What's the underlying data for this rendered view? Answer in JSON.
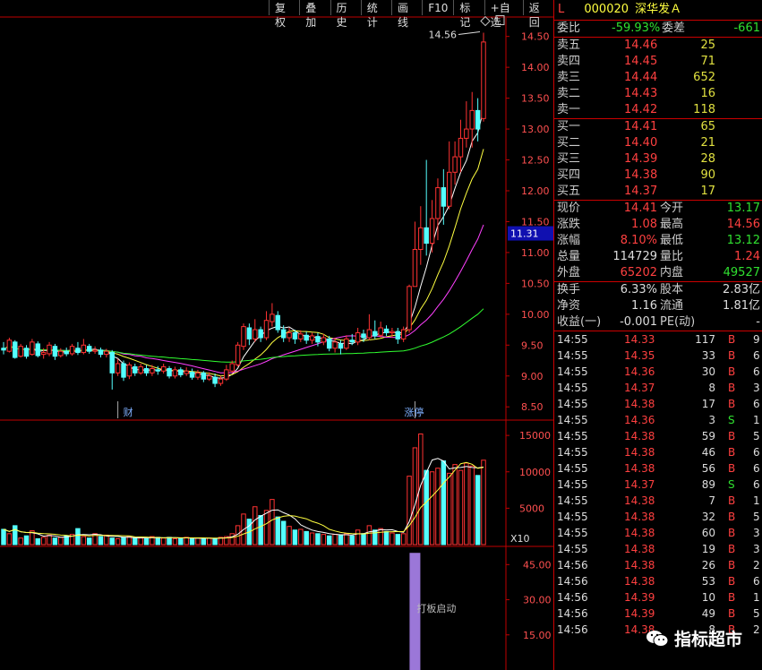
{
  "toolbar": {
    "items": [
      "复权",
      "叠加",
      "历史",
      "统计",
      "画线",
      "F10",
      "标记",
      "+自选",
      "返回"
    ]
  },
  "stock": {
    "market": "L",
    "code": "000020",
    "name": "深华发Ａ"
  },
  "committee": {
    "ratio_label": "委比",
    "ratio_value": "-59.93%",
    "diff_label": "委差",
    "diff_value": "-661"
  },
  "asks": [
    {
      "label": "卖五",
      "price": "14.46",
      "vol": "25"
    },
    {
      "label": "卖四",
      "price": "14.45",
      "vol": "71"
    },
    {
      "label": "卖三",
      "price": "14.44",
      "vol": "652"
    },
    {
      "label": "卖二",
      "price": "14.43",
      "vol": "16"
    },
    {
      "label": "卖一",
      "price": "14.42",
      "vol": "118"
    }
  ],
  "bids": [
    {
      "label": "买一",
      "price": "14.41",
      "vol": "65"
    },
    {
      "label": "买二",
      "price": "14.40",
      "vol": "21"
    },
    {
      "label": "买三",
      "price": "14.39",
      "vol": "28"
    },
    {
      "label": "买四",
      "price": "14.38",
      "vol": "90"
    },
    {
      "label": "买五",
      "price": "14.37",
      "vol": "17"
    }
  ],
  "quote": [
    {
      "l1": "现价",
      "v1": "14.41",
      "c1": "red",
      "l2": "今开",
      "v2": "13.17",
      "c2": "green"
    },
    {
      "l1": "涨跌",
      "v1": "1.08",
      "c1": "red",
      "l2": "最高",
      "v2": "14.56",
      "c2": "red"
    },
    {
      "l1": "涨幅",
      "v1": "8.10%",
      "c1": "red",
      "l2": "最低",
      "v2": "13.12",
      "c2": "green"
    },
    {
      "l1": "总量",
      "v1": "114729",
      "c1": "white",
      "l2": "量比",
      "v2": "1.24",
      "c2": "red"
    },
    {
      "l1": "外盘",
      "v1": "65202",
      "c1": "red",
      "l2": "内盘",
      "v2": "49527",
      "c2": "green"
    }
  ],
  "fundamentals": [
    {
      "l1": "换手",
      "v1": "6.33%",
      "l2": "股本",
      "v2": "2.83亿"
    },
    {
      "l1": "净资",
      "v1": "1.16",
      "l2": "流通",
      "v2": "1.81亿"
    },
    {
      "l1": "收益(一)",
      "v1": "-0.001",
      "l2": "PE(动)",
      "v2": "-"
    }
  ],
  "ticks": [
    {
      "time": "14:55",
      "price": "14.33",
      "vol": "117",
      "bs": "B",
      "n": "9"
    },
    {
      "time": "14:55",
      "price": "14.35",
      "vol": "33",
      "bs": "B",
      "n": "6"
    },
    {
      "time": "14:55",
      "price": "14.36",
      "vol": "30",
      "bs": "B",
      "n": "6"
    },
    {
      "time": "14:55",
      "price": "14.37",
      "vol": "8",
      "bs": "B",
      "n": "3"
    },
    {
      "time": "14:55",
      "price": "14.38",
      "vol": "17",
      "bs": "B",
      "n": "6"
    },
    {
      "time": "14:55",
      "price": "14.36",
      "vol": "3",
      "bs": "S",
      "n": "1"
    },
    {
      "time": "14:55",
      "price": "14.38",
      "vol": "59",
      "bs": "B",
      "n": "5"
    },
    {
      "time": "14:55",
      "price": "14.38",
      "vol": "46",
      "bs": "B",
      "n": "6"
    },
    {
      "time": "14:55",
      "price": "14.38",
      "vol": "56",
      "bs": "B",
      "n": "6"
    },
    {
      "time": "14:55",
      "price": "14.37",
      "vol": "89",
      "bs": "S",
      "n": "6"
    },
    {
      "time": "14:55",
      "price": "14.38",
      "vol": "7",
      "bs": "B",
      "n": "1"
    },
    {
      "time": "14:55",
      "price": "14.38",
      "vol": "32",
      "bs": "B",
      "n": "5"
    },
    {
      "time": "14:55",
      "price": "14.38",
      "vol": "60",
      "bs": "B",
      "n": "3"
    },
    {
      "time": "14:55",
      "price": "14.38",
      "vol": "19",
      "bs": "B",
      "n": "3"
    },
    {
      "time": "14:56",
      "price": "14.38",
      "vol": "26",
      "bs": "B",
      "n": "2"
    },
    {
      "time": "14:56",
      "price": "14.38",
      "vol": "53",
      "bs": "B",
      "n": "6"
    },
    {
      "time": "14:56",
      "price": "14.39",
      "vol": "10",
      "bs": "B",
      "n": "1"
    },
    {
      "time": "14:56",
      "price": "14.39",
      "vol": "49",
      "bs": "B",
      "n": "5"
    },
    {
      "time": "14:56",
      "price": "14.38",
      "vol": "8",
      "bs": "B",
      "n": "2"
    }
  ],
  "watermark": "指标超市",
  "colors": {
    "up": "#ff3232",
    "down": "#54ffff",
    "ma5": "#ffffff",
    "ma10": "#ffff40",
    "ma20": "#ff40ff",
    "ma60": "#30ff30",
    "indicator": "#9b77d8",
    "divider": "#c00000"
  },
  "chart_data": [
    {
      "type": "candlestick",
      "price_axis": {
        "ticks": [
          "14.50",
          "14.00",
          "13.50",
          "13.00",
          "12.50",
          "12.00",
          "11.50",
          "11.00",
          "10.50",
          "10.00",
          "9.50",
          "9.00",
          "8.50"
        ],
        "ylim": [
          8.3,
          14.8
        ],
        "current_marker": "11.31"
      },
      "high_marker": "14.56",
      "annotations": [
        {
          "text": "财",
          "index": 20
        },
        {
          "text": "涨停",
          "index": 72
        }
      ],
      "candles": [
        [
          9.45,
          9.42,
          9.55,
          9.35
        ],
        [
          9.4,
          9.58,
          9.62,
          9.38
        ],
        [
          9.55,
          9.3,
          9.58,
          9.28
        ],
        [
          9.32,
          9.48,
          9.52,
          9.3
        ],
        [
          9.45,
          9.32,
          9.5,
          9.28
        ],
        [
          9.35,
          9.55,
          9.6,
          9.33
        ],
        [
          9.52,
          9.33,
          9.56,
          9.3
        ],
        [
          9.35,
          9.38,
          9.45,
          9.28
        ],
        [
          9.36,
          9.5,
          9.55,
          9.32
        ],
        [
          9.48,
          9.32,
          9.52,
          9.26
        ],
        [
          9.33,
          9.4,
          9.45,
          9.3
        ],
        [
          9.4,
          9.36,
          9.46,
          9.32
        ],
        [
          9.36,
          9.48,
          9.52,
          9.33
        ],
        [
          9.45,
          9.38,
          9.55,
          9.34
        ],
        [
          9.38,
          9.5,
          9.6,
          9.35
        ],
        [
          9.48,
          9.4,
          9.52,
          9.36
        ],
        [
          9.4,
          9.42,
          9.48,
          9.36
        ],
        [
          9.42,
          9.35,
          9.46,
          9.3
        ],
        [
          9.35,
          9.4,
          9.44,
          9.3
        ],
        [
          9.38,
          9.05,
          9.42,
          8.78
        ],
        [
          9.05,
          9.2,
          9.28,
          9.0
        ],
        [
          9.2,
          8.98,
          9.25,
          8.92
        ],
        [
          9.0,
          9.18,
          9.22,
          8.95
        ],
        [
          9.15,
          9.05,
          9.2,
          9.0
        ],
        [
          9.05,
          9.15,
          9.2,
          9.02
        ],
        [
          9.12,
          9.05,
          9.18,
          9.0
        ],
        [
          9.05,
          9.12,
          9.18,
          9.0
        ],
        [
          9.1,
          9.08,
          9.16,
          9.02
        ],
        [
          9.08,
          9.15,
          9.2,
          9.04
        ],
        [
          9.12,
          9.0,
          9.16,
          8.96
        ],
        [
          9.0,
          9.1,
          9.15,
          8.96
        ],
        [
          9.1,
          9.02,
          9.14,
          8.98
        ],
        [
          9.04,
          9.08,
          9.14,
          9.0
        ],
        [
          9.06,
          8.98,
          9.12,
          8.94
        ],
        [
          8.98,
          9.05,
          9.1,
          8.94
        ],
        [
          9.05,
          8.95,
          9.08,
          8.9
        ],
        [
          8.95,
          9.0,
          9.06,
          8.92
        ],
        [
          8.98,
          8.88,
          9.04,
          8.82
        ],
        [
          8.88,
          8.95,
          9.0,
          8.84
        ],
        [
          8.95,
          9.1,
          9.18,
          8.92
        ],
        [
          9.08,
          9.2,
          9.25,
          9.05
        ],
        [
          9.18,
          9.5,
          9.55,
          9.15
        ],
        [
          9.48,
          9.8,
          9.85,
          9.42
        ],
        [
          9.78,
          9.6,
          9.85,
          9.5
        ],
        [
          9.6,
          9.75,
          9.92,
          9.55
        ],
        [
          9.75,
          9.62,
          9.8,
          9.55
        ],
        [
          9.62,
          9.9,
          10.05,
          9.58
        ],
        [
          9.88,
          10.0,
          10.18,
          9.8
        ],
        [
          9.98,
          9.75,
          10.05,
          9.7
        ],
        [
          9.75,
          9.62,
          9.82,
          9.55
        ],
        [
          9.62,
          9.7,
          9.78,
          9.55
        ],
        [
          9.7,
          9.6,
          9.75,
          9.52
        ],
        [
          9.6,
          9.68,
          9.74,
          9.55
        ],
        [
          9.66,
          9.58,
          9.72,
          9.52
        ],
        [
          9.58,
          9.65,
          9.7,
          9.52
        ],
        [
          9.64,
          9.55,
          9.7,
          9.48
        ],
        [
          9.55,
          9.62,
          9.68,
          9.5
        ],
        [
          9.6,
          9.45,
          9.65,
          9.4
        ],
        [
          9.45,
          9.55,
          9.62,
          9.38
        ],
        [
          9.52,
          9.45,
          9.58,
          9.35
        ],
        [
          9.45,
          9.6,
          9.66,
          9.42
        ],
        [
          9.58,
          9.55,
          9.68,
          9.5
        ],
        [
          9.55,
          9.7,
          9.78,
          9.5
        ],
        [
          9.68,
          9.62,
          9.75,
          9.55
        ],
        [
          9.62,
          9.75,
          10.0,
          9.58
        ],
        [
          9.72,
          9.65,
          9.9,
          9.6
        ],
        [
          9.66,
          9.78,
          9.88,
          9.62
        ],
        [
          9.76,
          9.7,
          9.82,
          9.65
        ],
        [
          9.7,
          9.72,
          9.78,
          9.62
        ],
        [
          9.72,
          9.6,
          9.78,
          9.52
        ],
        [
          9.6,
          9.75,
          9.8,
          9.55
        ],
        [
          9.75,
          10.45,
          10.48,
          9.7
        ],
        [
          10.45,
          11.05,
          11.5,
          10.6
        ],
        [
          11.05,
          11.4,
          11.75,
          10.8
        ],
        [
          11.4,
          11.15,
          12.5,
          10.95
        ],
        [
          11.15,
          11.55,
          11.85,
          11.0
        ],
        [
          11.55,
          12.05,
          12.2,
          11.2
        ],
        [
          12.05,
          11.75,
          12.35,
          11.45
        ],
        [
          11.75,
          12.3,
          12.8,
          11.7
        ],
        [
          12.3,
          12.55,
          12.8,
          12.1
        ],
        [
          12.55,
          12.85,
          13.15,
          12.3
        ],
        [
          12.85,
          13.0,
          13.45,
          12.7
        ],
        [
          13.0,
          13.3,
          13.6,
          12.7
        ],
        [
          13.3,
          13.0,
          13.5,
          12.8
        ],
        [
          13.17,
          14.41,
          14.56,
          13.12
        ]
      ],
      "ma_colors": [
        "#ffffff",
        "#ffff40",
        "#ff40ff",
        "#30ff30"
      ]
    },
    {
      "type": "bar",
      "title": "volume",
      "unit_label": "X10",
      "y_ticks": [
        "15000",
        "10000",
        "5000"
      ],
      "ylim": [
        0,
        16000
      ],
      "values": [
        2100,
        1500,
        2600,
        900,
        1200,
        1900,
        800,
        1000,
        1300,
        900,
        1000,
        1200,
        1400,
        2200,
        1100,
        900,
        1500,
        1100,
        1300,
        900,
        800,
        1000,
        1100,
        900,
        900,
        800,
        1100,
        1000,
        900,
        1000,
        800,
        900,
        1000,
        800,
        900,
        800,
        900,
        850,
        1000,
        1100,
        1500,
        2600,
        4200,
        3500,
        5200,
        4000,
        4700,
        6200,
        3800,
        3200,
        2500,
        2000,
        2100,
        1800,
        1600,
        1500,
        1400,
        1200,
        1400,
        1300,
        1500,
        1200,
        2000,
        1500,
        2600,
        2000,
        2200,
        1800,
        1600,
        1400,
        1500,
        9400,
        13300,
        15200,
        10200,
        10000,
        10500,
        11500,
        9800,
        11000,
        10200,
        11200,
        10800,
        9500,
        11600
      ],
      "series": [
        {
          "name": "MA5",
          "color": "#ffffff"
        },
        {
          "name": "MA10",
          "color": "#ffff40"
        }
      ]
    },
    {
      "type": "bar",
      "y_ticks": [
        "45.00",
        "30.00",
        "15.00"
      ],
      "ylim": [
        0,
        52
      ],
      "values": [
        {
          "index": 72,
          "value": 50
        }
      ],
      "label": "打板启动"
    }
  ]
}
